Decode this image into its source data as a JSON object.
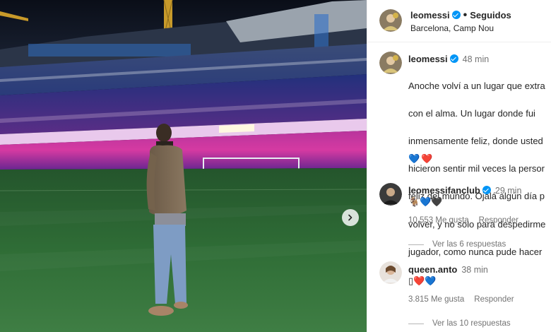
{
  "post": {
    "username": "leomessi",
    "follow_status": "Seguidos",
    "location": "Barcelona, Camp Nou",
    "time": "48 min",
    "caption": "Anoche volví a un lugar que extraño con el alma. Un lugar donde fui inmensamente feliz, donde ustedes me hicieron sentir mil veces la persona más feliz del mundo. Ojalá algún día pueda volver, y no solo para despedirme como jugador, como nunca pude hacerlo...",
    "caption_lines": [
      "Anoche volví a un lugar que extra",
      "con el alma. Un lugar donde fui",
      "inmensamente feliz, donde usted",
      "hicieron sentir mil veces la persor",
      "feliz del mundo. Ojalá algún día p",
      "volver, y no solo para despedirme",
      "jugador, como nunca pude hacer"
    ],
    "reactions": "💙❤️"
  },
  "comments": [
    {
      "username": "leomessifanclub",
      "time": "29 min",
      "text": "🐐💙🖤",
      "likes": "10.553 Me gusta",
      "reply_label": "Responder",
      "view_replies": "Ver las 6 respuestas"
    },
    {
      "username": "queen.anto",
      "time": "38 min",
      "text": "▯❤️💙",
      "likes": "3.815 Me gusta",
      "reply_label": "Responder",
      "view_replies": "Ver las 10 respuestas"
    }
  ],
  "icons": {
    "verified": "verified-badge-icon",
    "next": "chevron-right-icon"
  },
  "colors": {
    "verified": "#0095f6",
    "secondary_text": "#737373",
    "stadium_seats_blue": "#1f2f86",
    "stadium_seats_magenta": "#d23aa0",
    "pitch": "#2d6b34"
  }
}
